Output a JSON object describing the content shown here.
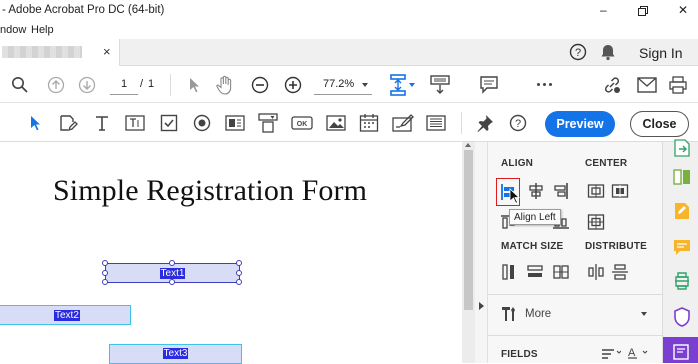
{
  "window": {
    "title": "- Adobe Acrobat Pro DC (64-bit)",
    "minimize_glyph": "–",
    "restore_glyph": "❐",
    "close_glyph": "✕"
  },
  "menu": {
    "items": [
      "ndow",
      "Help"
    ]
  },
  "tab": {
    "close_glyph": "×"
  },
  "header": {
    "help_glyph": "?",
    "sign_in": "Sign In"
  },
  "toolbar": {
    "page_current": "1",
    "page_separator": "/",
    "page_total": "1",
    "zoom": "77.2%"
  },
  "formbar": {
    "preview_label": "Preview",
    "close_label": "Close"
  },
  "document": {
    "title": "Simple Registration Form",
    "fields": [
      {
        "name": "Text1"
      },
      {
        "name": "Text2"
      },
      {
        "name": "Text3"
      }
    ]
  },
  "panel": {
    "align_label": "ALIGN",
    "center_label": "CENTER",
    "match_size_label": "MATCH SIZE",
    "distribute_label": "DISTRIBUTE",
    "tooltip": "Align Left",
    "more_label": "More",
    "fields_label": "FIELDS"
  },
  "colors": {
    "accent_blue": "#1473e6",
    "field_border": "#3d3dbf",
    "field_fill": "#d8ddf7",
    "selection_fill": "#2b2be0",
    "highlight_red": "#e01b1b",
    "rail_purple": "#7a3fd1"
  }
}
